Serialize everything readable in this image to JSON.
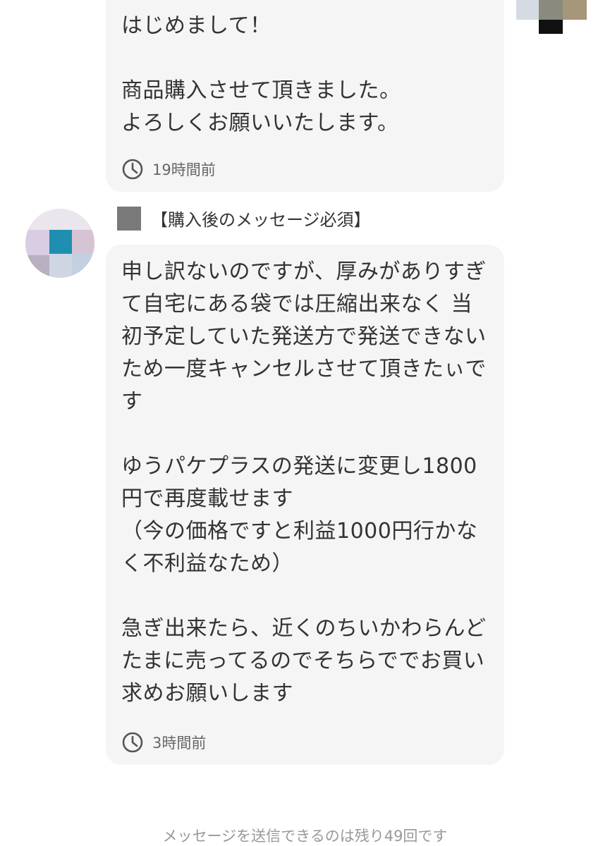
{
  "messages": [
    {
      "text": "はじめまして！\n\n商品購入させて頂きました。\nよろしくお願いいたします。",
      "time": "19時間前"
    },
    {
      "sender": "【購入後のメッセージ必須】",
      "text": "申し訳ないのですが、厚みがありすぎ\nて自宅にある袋では圧縮出来なく 当\n初予定していた発送方で発送できない\nため一度キャンセルさせて頂きたぃで\nす\n\nゆうパケプラスの発送に変更し1800\n円で再度載せます\n（今の価格ですと利益1000円行かな\nく不利益なため）\n\n急ぎ出来たら、近くのちいかわらんど\nたまに売ってるのでそちらででお買い\n求めお願いします",
      "time": "3時間前"
    }
  ],
  "footer": {
    "remaining_notice": "メッセージを送信できるのは残り49回です"
  },
  "icons": {
    "timestamp": "clock-icon",
    "avatar": "user-avatar",
    "own_avatar": "own-user-avatar"
  },
  "colors": {
    "bubble_background": "#f5f5f5",
    "text": "#333333",
    "timestamp_text": "#666666",
    "footer_text": "#999999"
  }
}
